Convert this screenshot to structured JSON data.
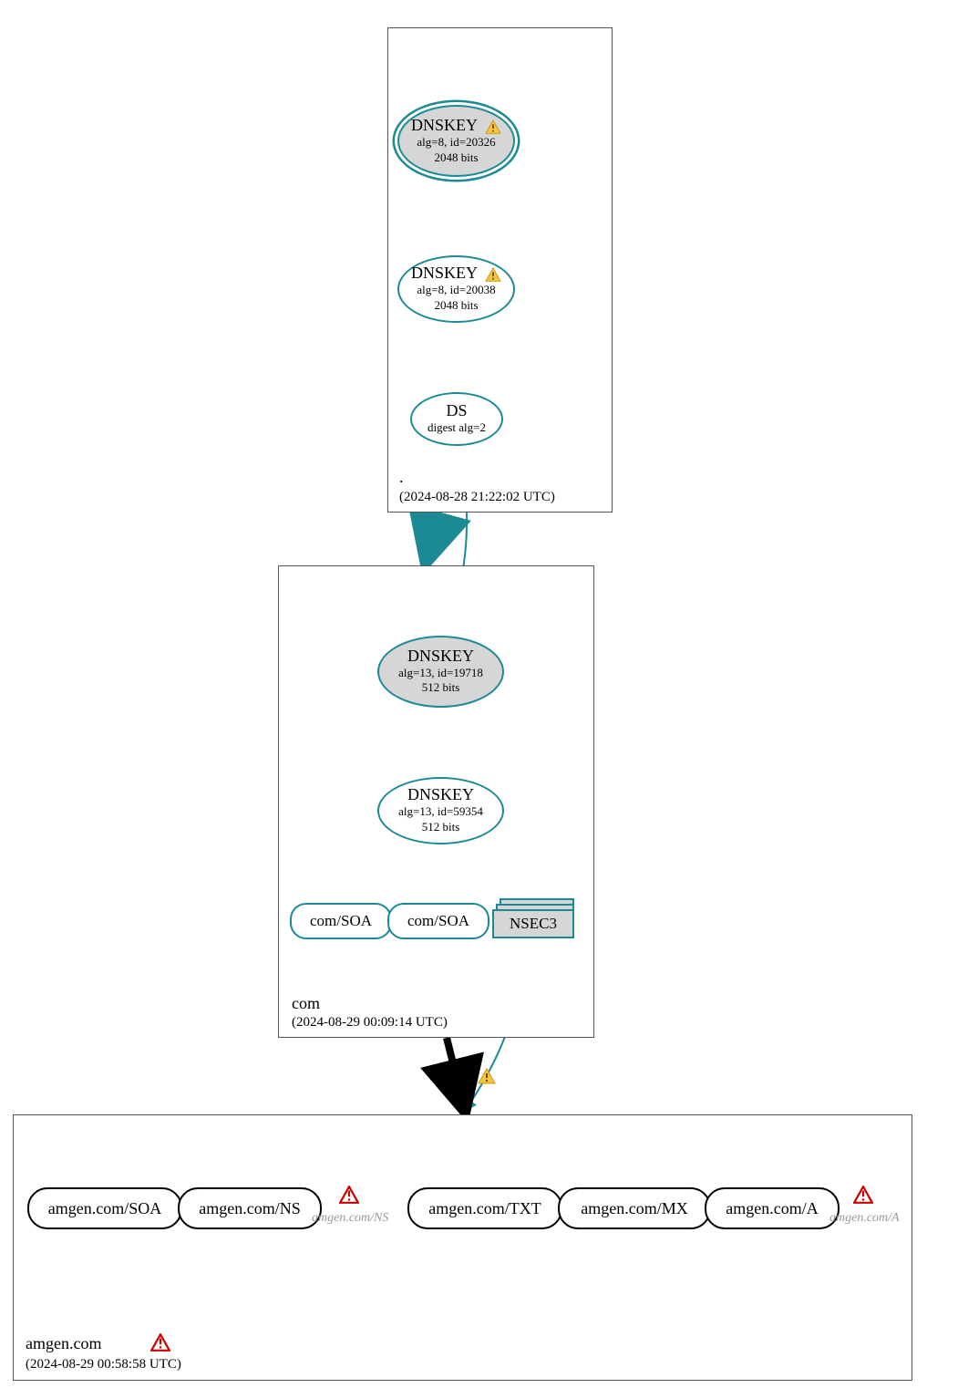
{
  "zones": {
    "root": {
      "label": ".",
      "timestamp": "(2024-08-28 21:22:02 UTC)",
      "nodes": {
        "ksk": {
          "title": "DNSKEY",
          "alg": "alg=8, id=20326",
          "bits": "2048 bits",
          "warn": true
        },
        "zsk": {
          "title": "DNSKEY",
          "alg": "alg=8, id=20038",
          "bits": "2048 bits",
          "warn": true
        },
        "ds": {
          "title": "DS",
          "sub": "digest alg=2"
        }
      }
    },
    "com": {
      "label": "com",
      "timestamp": "(2024-08-29 00:09:14 UTC)",
      "nodes": {
        "ksk": {
          "title": "DNSKEY",
          "alg": "alg=13, id=19718",
          "bits": "512 bits"
        },
        "zsk": {
          "title": "DNSKEY",
          "alg": "alg=13, id=59354",
          "bits": "512 bits"
        },
        "soa1": {
          "label": "com/SOA"
        },
        "soa2": {
          "label": "com/SOA"
        },
        "nsec3": {
          "label": "NSEC3"
        }
      }
    },
    "amgen": {
      "label": "amgen.com",
      "timestamp": "(2024-08-29 00:58:58 UTC)",
      "error": true,
      "records": [
        {
          "label": "amgen.com/SOA"
        },
        {
          "label": "amgen.com/NS"
        },
        {
          "ghost": "amgen.com/NS",
          "error": true
        },
        {
          "label": "amgen.com/TXT"
        },
        {
          "label": "amgen.com/MX"
        },
        {
          "label": "amgen.com/A"
        },
        {
          "ghost": "amgen.com/A",
          "error": true
        }
      ]
    }
  },
  "delegation_warn": true
}
